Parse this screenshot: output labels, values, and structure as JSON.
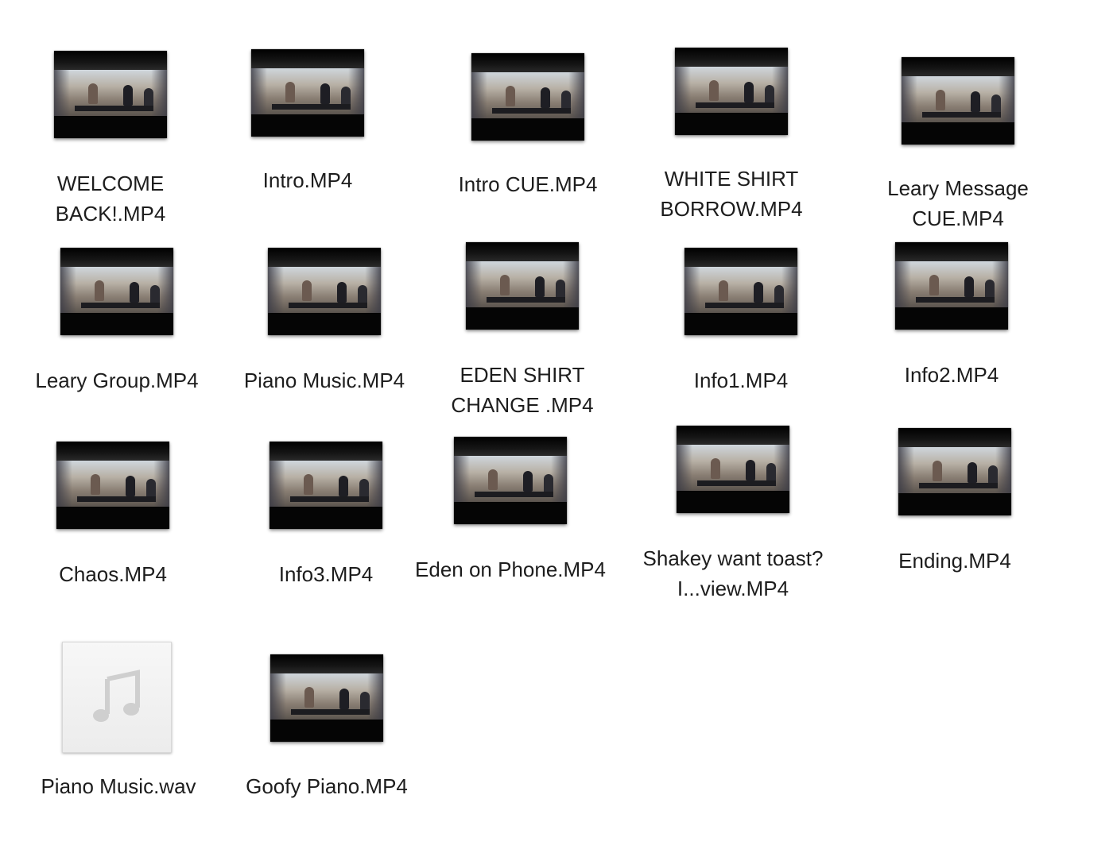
{
  "files": [
    {
      "name": "WELCOME BACK!.MP4",
      "kind": "video"
    },
    {
      "name": "Intro.MP4",
      "kind": "video"
    },
    {
      "name": "Intro CUE.MP4",
      "kind": "video"
    },
    {
      "name": "WHITE SHIRT BORROW.MP4",
      "kind": "video"
    },
    {
      "name": "Leary Message CUE.MP4",
      "kind": "video"
    },
    {
      "name": "Leary Group.MP4",
      "kind": "video"
    },
    {
      "name": "Piano Music.MP4",
      "kind": "video"
    },
    {
      "name": "EDEN SHIRT CHANGE .MP4",
      "kind": "video"
    },
    {
      "name": "Info1.MP4",
      "kind": "video"
    },
    {
      "name": "Info2.MP4",
      "kind": "video"
    },
    {
      "name": "Chaos.MP4",
      "kind": "video"
    },
    {
      "name": "Info3.MP4",
      "kind": "video"
    },
    {
      "name": "Eden on Phone.MP4",
      "kind": "video"
    },
    {
      "name": "Shakey want toast? I...view.MP4",
      "kind": "video"
    },
    {
      "name": "Ending.MP4",
      "kind": "video"
    },
    {
      "name": "Piano Music.wav",
      "kind": "audio"
    },
    {
      "name": "Goofy Piano.MP4",
      "kind": "video"
    }
  ],
  "icons": {
    "video": "video-thumbnail-icon",
    "audio": "music-note-icon"
  }
}
